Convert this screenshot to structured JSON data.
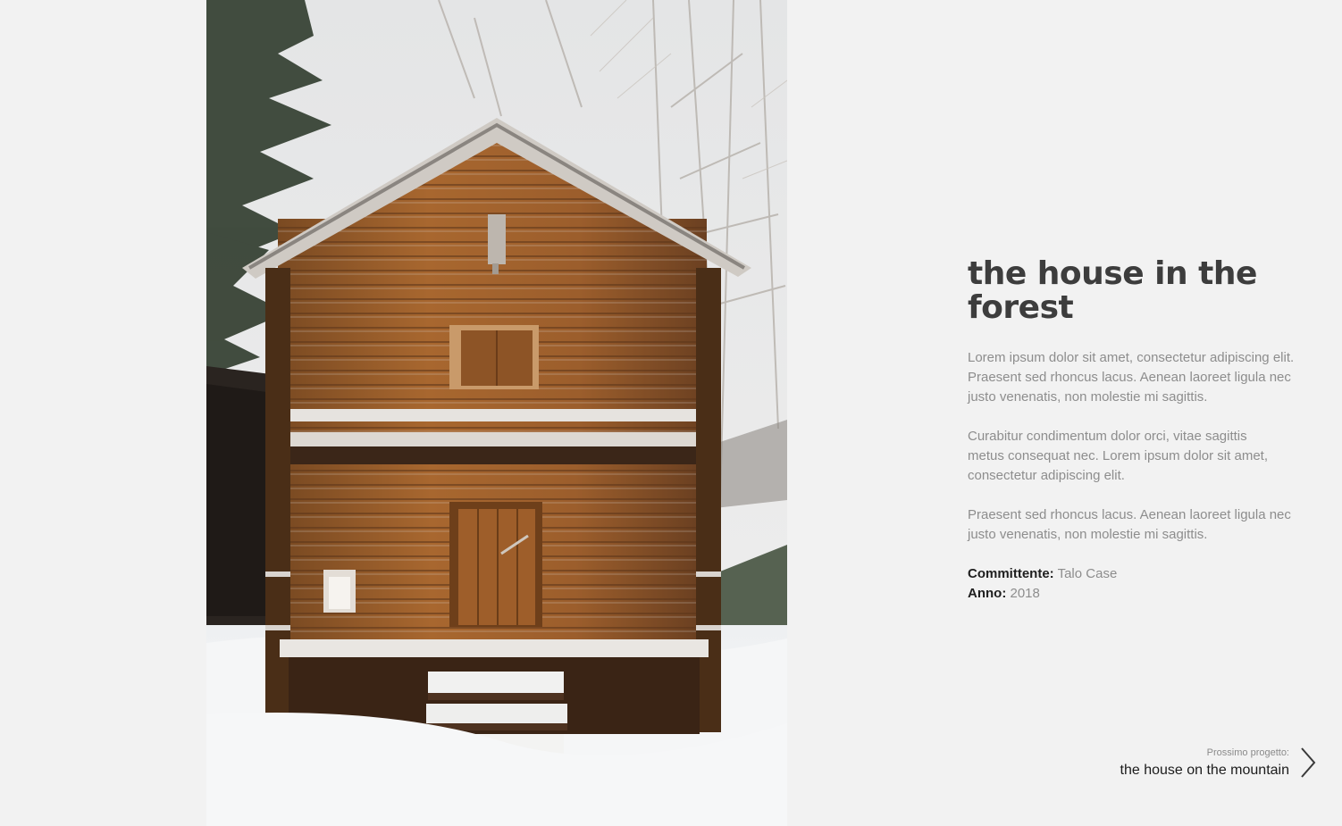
{
  "hero_image": {
    "description_icon": "cabin-photo"
  },
  "project": {
    "title": "the house in the forest",
    "paragraphs": [
      "Lorem ipsum dolor sit amet, consectetur adipiscing elit.\nPraesent sed rhoncus lacus.  Aenean laoreet ligula nec\n justo venenatis, non molestie mi sagittis.",
      "Curabitur condimentum dolor orci, vitae sagittis\nmetus consequat nec. Lorem ipsum dolor sit amet,\nconsectetur adipiscing elit.",
      "Praesent sed rhoncus lacus.  Aenean laoreet ligula nec\n justo venenatis, non molestie mi sagittis."
    ],
    "meta": {
      "client_label": "Committente:",
      "client_value": "Talo Case",
      "year_label": "Anno:",
      "year_value": "2018"
    }
  },
  "next_project": {
    "kicker": "Prossimo progetto:",
    "title": "the house on the mountain",
    "icon": "chevron-right-icon"
  },
  "colors": {
    "background": "#f2f2f2",
    "title": "#3d3d3d",
    "body_text": "#8d8d8d",
    "meta_label": "#1f1f1f"
  }
}
